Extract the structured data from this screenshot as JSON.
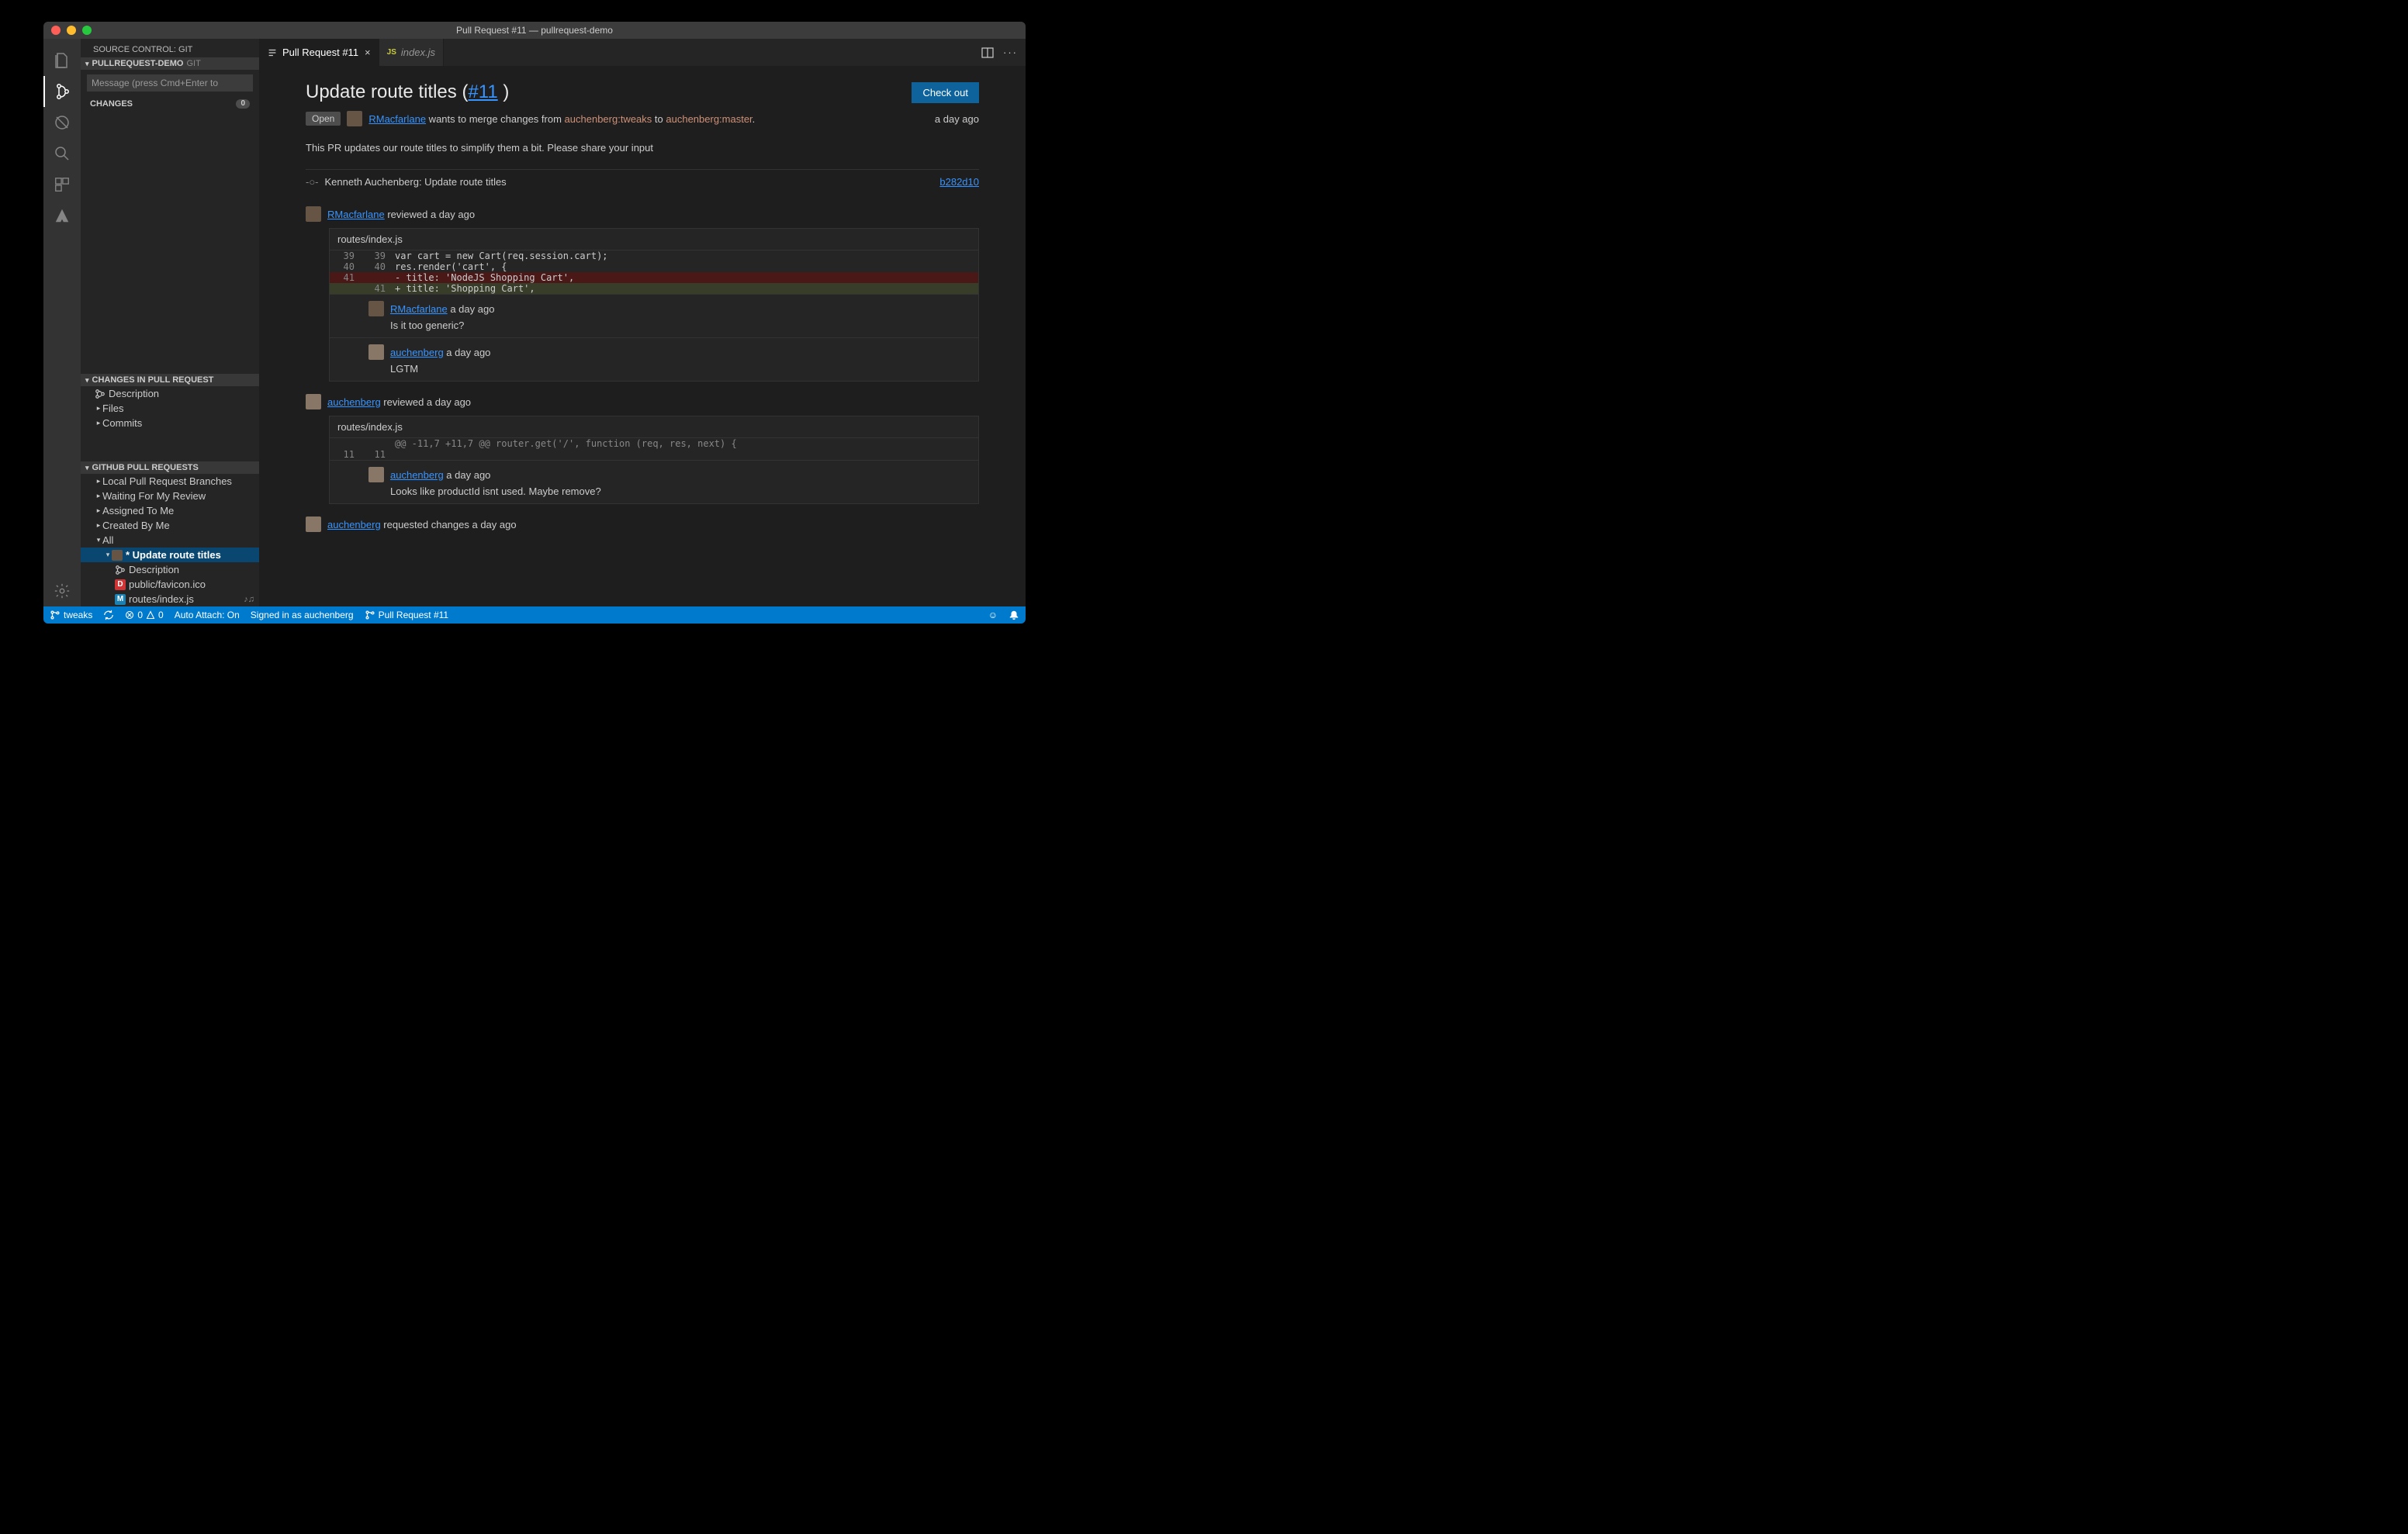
{
  "window": {
    "title": "Pull Request #11 — pullrequest-demo"
  },
  "sidebar": {
    "title": "SOURCE CONTROL: GIT",
    "repo_header": "PULLREQUEST-DEMO",
    "repo_dim": "GIT",
    "message_placeholder": "Message (press Cmd+Enter to",
    "changes_label": "CHANGES",
    "changes_count": "0",
    "changes_in_pr_label": "CHANGES IN PULL REQUEST",
    "pr_tree": {
      "description": "Description",
      "files": "Files",
      "commits": "Commits"
    },
    "github_header": "GITHUB PULL REQUESTS",
    "github": {
      "local": "Local Pull Request Branches",
      "waiting": "Waiting For My Review",
      "assigned": "Assigned To Me",
      "created": "Created By Me",
      "all": "All",
      "selected": "* Update route titles",
      "desc": "Description",
      "f1": "public/favicon.ico",
      "f2": "routes/index.js",
      "f2_tail": "♪♫"
    }
  },
  "tabs": {
    "t1": "Pull Request #11",
    "t2": "index.js"
  },
  "pr": {
    "title_prefix": "Update route titles (",
    "title_link": "#11",
    "title_suffix": " )",
    "status": "Open",
    "author": "RMacfarlane",
    "merge_text": " wants to merge changes from ",
    "branch_from": "auchenberg:tweaks",
    "to_text": " to ",
    "branch_to": "auchenberg:master",
    "dot": ".",
    "time": "a day ago",
    "desc": "This PR updates our route titles to simplify them a bit. Please share your input",
    "commit_author": "Kenneth Auchenberg: Update route titles",
    "commit_sha": "b282d10",
    "checkout": "Check out"
  },
  "review1": {
    "user": "RMacfarlane",
    "action": " reviewed a day ago",
    "file": "routes/index.js",
    "lines": [
      {
        "o": "39",
        "n": "39",
        "code": "var cart = new Cart(req.session.cart);",
        "cls": ""
      },
      {
        "o": "40",
        "n": "40",
        "code": "res.render('cart', {",
        "cls": ""
      },
      {
        "o": "41",
        "n": "",
        "code": "- title: 'NodeJS Shopping Cart',",
        "cls": "del"
      },
      {
        "o": "",
        "n": "41",
        "code": "+ title: 'Shopping Cart',",
        "cls": "add"
      }
    ],
    "c1_user": "RMacfarlane",
    "c1_time": "a day ago",
    "c1_body": "Is it too generic?",
    "c2_user": "auchenberg",
    "c2_time": "a day ago",
    "c2_body": "LGTM"
  },
  "review2": {
    "user": "auchenberg",
    "action": " reviewed a day ago",
    "file": "routes/index.js",
    "hunk": "@@ -11,7 +11,7 @@ router.get('/', function (req, res, next) {",
    "ln_o": "11",
    "ln_n": "11",
    "c1_user": "auchenberg",
    "c1_time": "a day ago",
    "c1_body": "Looks like productId isnt used. Maybe remove?"
  },
  "review3": {
    "user": "auchenberg",
    "action": " requested changes a day ago"
  },
  "status": {
    "branch": "tweaks",
    "errors": "0",
    "warnings": "0",
    "auto_attach": "Auto Attach: On",
    "signed_in": "Signed in as auchenberg",
    "pr": "Pull Request #11"
  }
}
